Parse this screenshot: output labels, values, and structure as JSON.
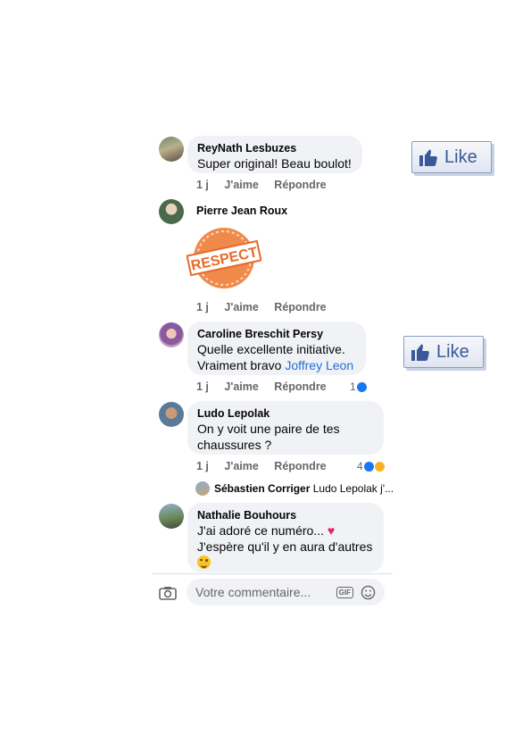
{
  "comments": [
    {
      "author": "ReyNath Lesbuzes",
      "text": "Super original!  Beau boulot!",
      "time": "1 j",
      "like": "J'aime",
      "reply": "Répondre"
    },
    {
      "author": "Pierre Jean Roux",
      "sticker_text": "RESPECT",
      "time": "1 j",
      "like": "J'aime",
      "reply": "Répondre"
    },
    {
      "author": "Caroline Breschit Persy",
      "text_line1": "Quelle excellente initiative.",
      "text_line2_prefix": "Vraiment bravo",
      "mention": "Joffrey Leon",
      "time": "1 j",
      "like": "J'aime",
      "reply": "Répondre",
      "reactions": "1"
    },
    {
      "author": "Ludo Lepolak",
      "text_line1": "On y voit une paire de tes",
      "text_line2": "chaussures ?",
      "time": "1 j",
      "like": "J'aime",
      "reply": "Répondre",
      "reactions": "4"
    },
    {
      "author": "Nathalie Bouhours",
      "text_line1": "J'ai adoré ce numéro...",
      "text_line2": "J'espère qu'il y en aura d'autres",
      "emoji1": "heart-icon",
      "emoji2": "wink-emoji-icon"
    }
  ],
  "reply_preview": {
    "author": "Sébastien Corriger",
    "text": "Ludo Lepolak j'..."
  },
  "like_badges": [
    "Like",
    "Like"
  ],
  "composer": {
    "placeholder": "Votre commentaire...",
    "gif_label": "GIF",
    "camera_icon": "camera-icon",
    "emoji_icon": "smiley-icon"
  },
  "colors": {
    "bubble": "#f0f2f5",
    "mention": "#216fdb",
    "meta": "#65676b",
    "like_brand": "#3b5998"
  }
}
